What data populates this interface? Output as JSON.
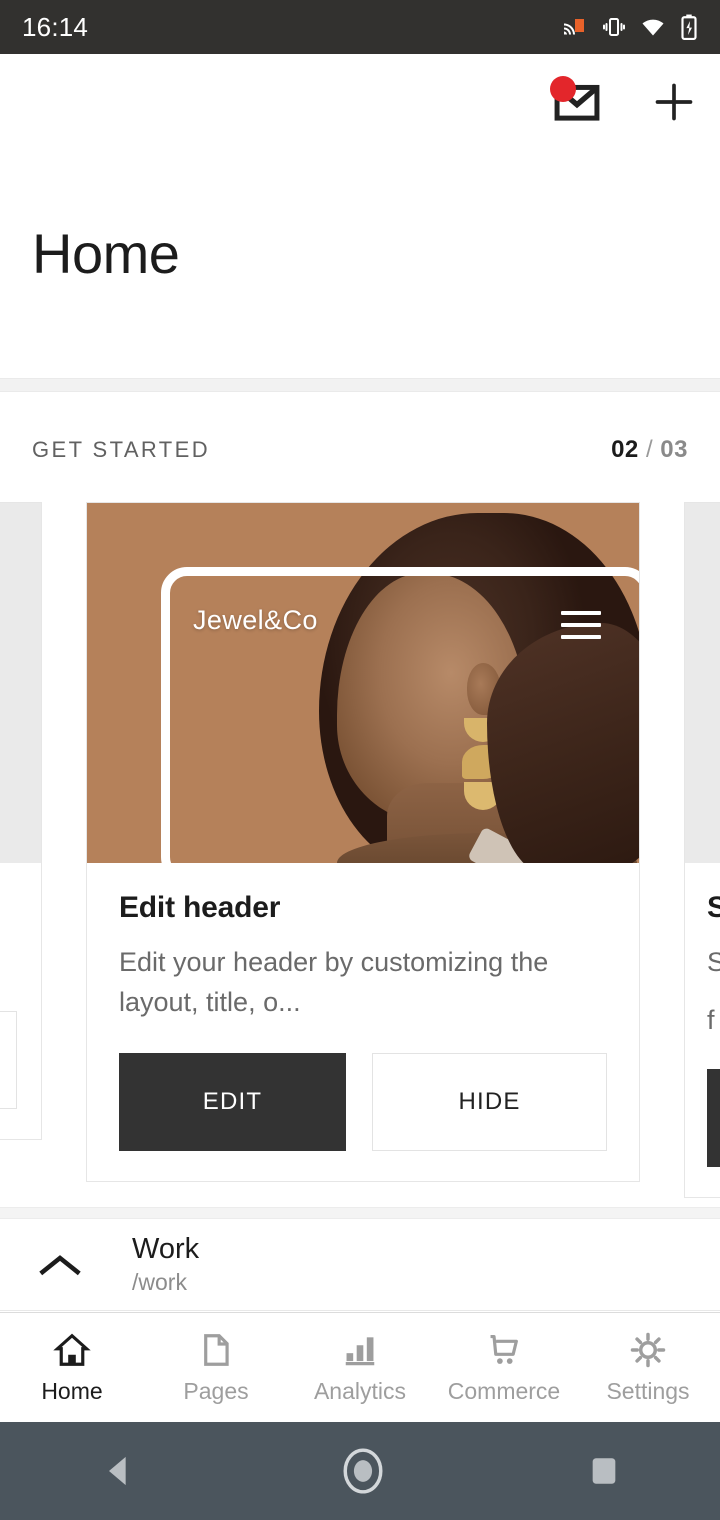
{
  "statusbar": {
    "time": "16:14",
    "icons": [
      "cast-icon",
      "vibrate-icon",
      "wifi-icon",
      "battery-charging-icon"
    ],
    "background": "#32312f",
    "cast_color": "#e8622a"
  },
  "appbar": {
    "mail_icon": "mail-icon",
    "badge_color": "#e3262b",
    "add_icon": "plus-icon"
  },
  "page": {
    "title": "Home"
  },
  "get_started": {
    "label": "GET STARTED",
    "current": "02",
    "separator": "/",
    "total": "03"
  },
  "carousel": {
    "active_index": 1,
    "cards": [
      {
        "id": "card-prev",
        "title": "",
        "description": "",
        "primary_label": "",
        "secondary_label": ""
      },
      {
        "id": "card-edit-header",
        "title": "Edit header",
        "description": "Edit your header by customizing the layout, title, o...",
        "primary_label": "EDIT",
        "secondary_label": "HIDE",
        "image": {
          "brand": "Jewel&Co",
          "menu_icon": "hamburger-icon",
          "background": "#b5815a"
        }
      },
      {
        "id": "card-next",
        "title": "S",
        "description_line1": "S",
        "description_line2": "f",
        "primary_label": ""
      }
    ]
  },
  "pages_list": [
    {
      "name": "Work",
      "path": "/work",
      "chevron": "chevron-up-icon"
    }
  ],
  "bottom_nav": {
    "items": [
      {
        "label": "Home",
        "icon": "home-icon",
        "active": true
      },
      {
        "label": "Pages",
        "icon": "page-icon",
        "active": false
      },
      {
        "label": "Analytics",
        "icon": "bar-chart-icon",
        "active": false
      },
      {
        "label": "Commerce",
        "icon": "cart-icon",
        "active": false
      },
      {
        "label": "Settings",
        "icon": "gear-icon",
        "active": false
      }
    ]
  },
  "softkeys": {
    "back": "back-triangle-icon",
    "home": "home-circle-icon",
    "recents": "recents-square-icon",
    "background": "#4b555d"
  }
}
